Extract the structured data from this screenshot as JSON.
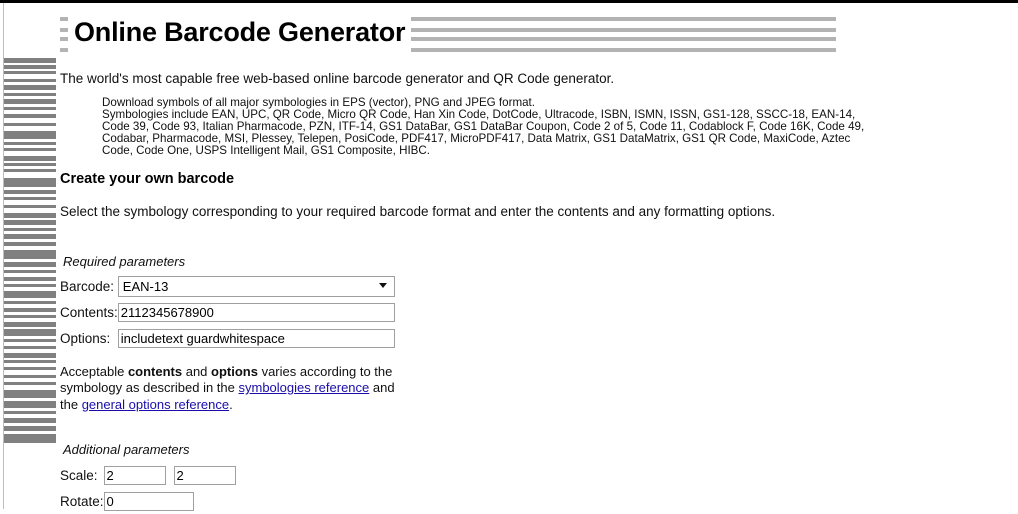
{
  "page": {
    "title": "Online Barcode Generator",
    "lead": "The world's most capable free web-based online barcode generator and QR Code generator.",
    "symbologies_lines": [
      "Download symbols of all major symbologies in EPS (vector), PNG and JPEG format.",
      "Symbologies include EAN, UPC, QR Code, Micro QR Code, Han Xin Code, DotCode, Ultracode, ISBN, ISMN, ISSN, GS1-128, SSCC-18, EAN-14, Code 39, Code 93, Italian Pharmacode, PZN, ITF-14, GS1 DataBar, GS1 DataBar Coupon, Code 2 of 5, Code 11, Codablock F, Code 16K, Code 49, Codabar, Pharmacode, MSI, Plessey, Telepen, PosiCode, PDF417, MicroPDF417, Data Matrix, GS1 DataMatrix, GS1 QR Code, MaxiCode, Aztec Code, Code One, USPS Intelligent Mail, GS1 Composite, HIBC."
    ],
    "section_title": "Create your own barcode",
    "instructions": "Select the symbology corresponding to your required barcode format and enter the contents and any formatting options."
  },
  "required_parameters": {
    "legend": "Required parameters",
    "barcode": {
      "label": "Barcode:",
      "value": "EAN-13",
      "options": [
        "EAN-13"
      ],
      "arrow_icon": "chevron-down-icon"
    },
    "contents": {
      "label": "Contents:",
      "value": "2112345678900",
      "placeholder": ""
    },
    "options": {
      "label": "Options:",
      "value": "includetext guardwhitespace",
      "placeholder": ""
    }
  },
  "note": {
    "part1": "Acceptable ",
    "bold1": "contents",
    "part2": " and ",
    "bold2": "options",
    "part3": " varies according to the symbology as described in the ",
    "link1": "symbologies reference",
    "part4": " and the ",
    "link2": "general options reference",
    "part5": "."
  },
  "additional_parameters": {
    "legend": "Additional parameters",
    "scale": {
      "label": "Scale:",
      "value_x": "2",
      "value_y": "2"
    },
    "rotate": {
      "label": "Rotate:",
      "value": "0"
    }
  },
  "decor": {
    "left_barcode_name": "left-barcode-strip",
    "title_banner_name": "title-barcode-banner",
    "bar_color": "#808080",
    "banner_color": "#b3b3b3",
    "link_color": "#1a0dab"
  }
}
